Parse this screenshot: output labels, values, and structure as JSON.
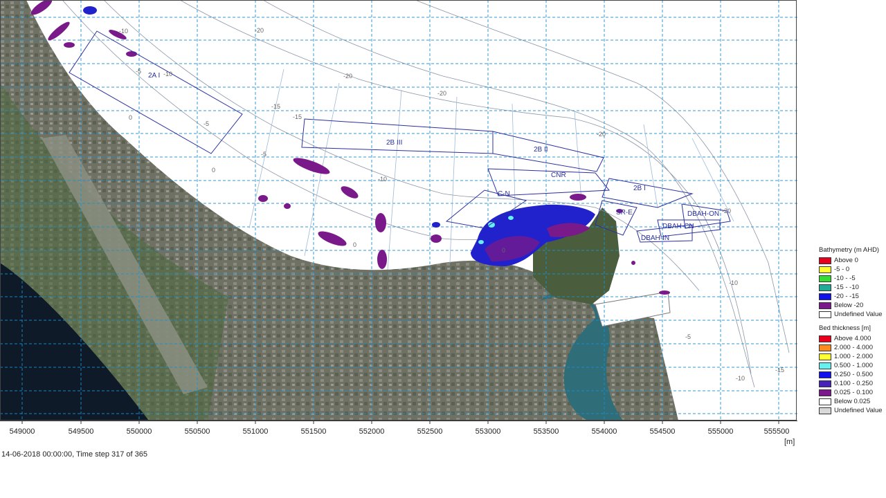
{
  "map": {
    "zones": [
      {
        "id": "2A I",
        "label": "2A I"
      },
      {
        "id": "2B III",
        "label": "2B III"
      },
      {
        "id": "2B II",
        "label": "2B II"
      },
      {
        "id": "CNR",
        "label": "CNR"
      },
      {
        "id": "C-N",
        "label": "C-N"
      },
      {
        "id": "2B I",
        "label": "2B I"
      },
      {
        "id": "SR-E",
        "label": "SR-E"
      },
      {
        "id": "DBAH-ON",
        "label": "DBAH-ON"
      },
      {
        "id": "DBAH-CN",
        "label": "DBAH-CN"
      },
      {
        "id": "DBAH-IN",
        "label": "DBAH-IN"
      }
    ],
    "contour_labels": [
      "-20",
      "-20",
      "-20",
      "-15",
      "-15",
      "-10",
      "-10",
      "-10",
      "-5",
      "-5",
      "-5",
      "0",
      "0",
      "0",
      "-10",
      "-15",
      "-20",
      "-20",
      "-10",
      "-5",
      "0"
    ]
  },
  "x_axis": {
    "ticks": [
      "549000",
      "549500",
      "550000",
      "550500",
      "551000",
      "551500",
      "552000",
      "552500",
      "553000",
      "553500",
      "554000",
      "554500",
      "555000",
      "555500"
    ],
    "unit": "[m]"
  },
  "status": "14-06-2018 00:00:00, Time step 317 of 365",
  "legend": {
    "bathymetry": {
      "title": "Bathymetry (m AHD)",
      "items": [
        {
          "label": "Above    0",
          "color": "#e8001c"
        },
        {
          "label": "-5 -    0",
          "color": "#ffff33"
        },
        {
          "label": "-10 -   -5",
          "color": "#33dd33"
        },
        {
          "label": "-15 - -10",
          "color": "#22aa99"
        },
        {
          "label": "-20 - -15",
          "color": "#1111ee"
        },
        {
          "label": "Below -20",
          "color": "#7a1a8a"
        },
        {
          "label": "Undefined Value",
          "color": "#ffffff"
        }
      ]
    },
    "bed_thickness": {
      "title": "Bed thickness [m]",
      "items": [
        {
          "label": "Above 4.000",
          "color": "#e8001c"
        },
        {
          "label": "2.000 - 4.000",
          "color": "#ff8c1a"
        },
        {
          "label": "1.000 - 2.000",
          "color": "#ffff33"
        },
        {
          "label": "0.500 - 1.000",
          "color": "#66f0f0"
        },
        {
          "label": "0.250 - 0.500",
          "color": "#1111ee"
        },
        {
          "label": "0.100 - 0.250",
          "color": "#4422bb"
        },
        {
          "label": "0.025 - 0.100",
          "color": "#7a1a8a"
        },
        {
          "label": "Below 0.025",
          "color": "#ffffff"
        },
        {
          "label": "Undefined Value",
          "color": "#d8d8d8"
        }
      ]
    }
  }
}
